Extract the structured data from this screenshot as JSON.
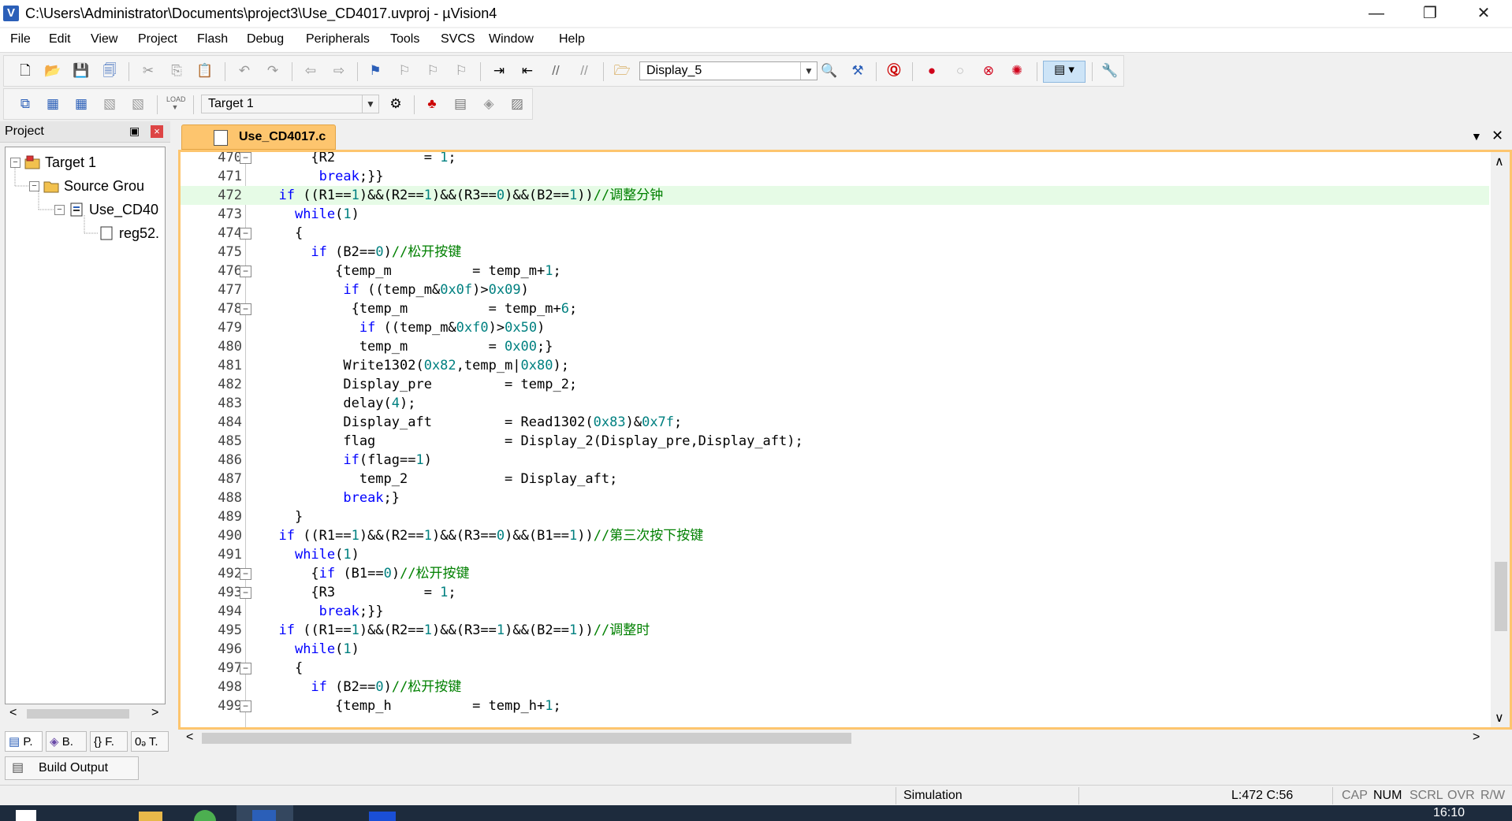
{
  "window": {
    "title": "C:\\Users\\Administrator\\Documents\\project3\\Use_CD4017.uvproj - µVision4",
    "icon_letter": "V",
    "buttons": {
      "minimize": "—",
      "restore": "❐",
      "close": "✕"
    }
  },
  "menu": [
    "File",
    "Edit",
    "View",
    "Project",
    "Flash",
    "Debug",
    "Peripherals",
    "Tools",
    "SVCS",
    "Window",
    "Help"
  ],
  "toolbar1": {
    "find_combo": "Display_5",
    "icons": [
      "new-file-icon",
      "open-icon",
      "save-icon",
      "save-all-icon",
      "cut-icon",
      "copy-icon",
      "paste-icon",
      "undo-icon",
      "redo-icon",
      "back-icon",
      "forward-icon",
      "bookmark-icon",
      "bookmark-prev-icon",
      "bookmark-next-icon",
      "bookmark-clear-icon",
      "indent-icon",
      "unindent-icon",
      "comment-icon",
      "uncomment-icon",
      "find-in-files-icon",
      "find-icon",
      "incremental-find-icon",
      "debug-start-icon",
      "breakpoint-icon",
      "breakpoint-disable-icon",
      "breakpoint-kill-icon",
      "breakpoint-kill-all-icon",
      "window-layout-icon",
      "configure-icon"
    ]
  },
  "toolbar2": {
    "target_combo": "Target 1",
    "load_label": "LOAD"
  },
  "project_panel": {
    "title": "Project",
    "pin": "▣",
    "close": "×",
    "tree": [
      {
        "label": "Target 1",
        "level": 0,
        "expander": "−"
      },
      {
        "label": "Source Grou",
        "level": 1,
        "expander": "−"
      },
      {
        "label": "Use_CD40",
        "level": 2,
        "expander": "−"
      },
      {
        "label": "reg52.",
        "level": 3,
        "expander": ""
      }
    ],
    "tabs": [
      "P.",
      "B.",
      "F.",
      "T."
    ],
    "scroll_left": "<",
    "scroll_right": ">"
  },
  "editor": {
    "tab_label": "Use_CD4017.c",
    "dropdown_icon": "▼",
    "close_icon": "✕",
    "current_line": 472,
    "lines": [
      {
        "n": "470",
        "fold": "−",
        "text": "      {R2           = 1;"
      },
      {
        "n": "471",
        "fold": "",
        "text": "       break;}}"
      },
      {
        "n": "472",
        "fold": "",
        "text": "  if ((R1==1)&&(R2==1)&&(R3==0)&&(B2==1))//调整分钟"
      },
      {
        "n": "473",
        "fold": "",
        "text": "    while(1)"
      },
      {
        "n": "474",
        "fold": "−",
        "text": "    {"
      },
      {
        "n": "475",
        "fold": "",
        "text": "      if (B2==0)//松开按键"
      },
      {
        "n": "476",
        "fold": "−",
        "text": "         {temp_m          = temp_m+1;"
      },
      {
        "n": "477",
        "fold": "",
        "text": "          if ((temp_m&0x0f)>0x09)"
      },
      {
        "n": "478",
        "fold": "−",
        "text": "           {temp_m          = temp_m+6;"
      },
      {
        "n": "479",
        "fold": "",
        "text": "            if ((temp_m&0xf0)>0x50)"
      },
      {
        "n": "480",
        "fold": "",
        "text": "            temp_m          = 0x00;}"
      },
      {
        "n": "481",
        "fold": "",
        "text": "          Write1302(0x82,temp_m|0x80);"
      },
      {
        "n": "482",
        "fold": "",
        "text": "          Display_pre         = temp_2;"
      },
      {
        "n": "483",
        "fold": "",
        "text": "          delay(4);"
      },
      {
        "n": "484",
        "fold": "",
        "text": "          Display_aft         = Read1302(0x83)&0x7f;"
      },
      {
        "n": "485",
        "fold": "",
        "text": "          flag                = Display_2(Display_pre,Display_aft);"
      },
      {
        "n": "486",
        "fold": "",
        "text": "          if(flag==1)"
      },
      {
        "n": "487",
        "fold": "",
        "text": "            temp_2            = Display_aft;"
      },
      {
        "n": "488",
        "fold": "",
        "text": "          break;}"
      },
      {
        "n": "489",
        "fold": "",
        "text": "    }"
      },
      {
        "n": "490",
        "fold": "",
        "text": "  if ((R1==1)&&(R2==1)&&(R3==0)&&(B1==1))//第三次按下按键"
      },
      {
        "n": "491",
        "fold": "",
        "text": "    while(1)"
      },
      {
        "n": "492",
        "fold": "−",
        "text": "      {if (B1==0)//松开按键"
      },
      {
        "n": "493",
        "fold": "−",
        "text": "      {R3           = 1;"
      },
      {
        "n": "494",
        "fold": "",
        "text": "       break;}}"
      },
      {
        "n": "495",
        "fold": "",
        "text": "  if ((R1==1)&&(R2==1)&&(R3==1)&&(B2==1))//调整时"
      },
      {
        "n": "496",
        "fold": "",
        "text": "    while(1)"
      },
      {
        "n": "497",
        "fold": "−",
        "text": "    {"
      },
      {
        "n": "498",
        "fold": "",
        "text": "      if (B2==0)//松开按键"
      },
      {
        "n": "499",
        "fold": "−",
        "text": "         {temp_h          = temp_h+1;"
      }
    ],
    "vscroll_up": "∧",
    "vscroll_down": "∨",
    "hscroll_left": "<",
    "hscroll_right": ">"
  },
  "build_output": {
    "label": "Build Output"
  },
  "status": {
    "mode": "Simulation",
    "position": "L:472 C:56",
    "flags": [
      "CAP",
      "NUM",
      "SCRL",
      "OVR",
      "R/W"
    ]
  },
  "taskbar": {
    "clock": "16:10"
  },
  "colors": {
    "keyword": "#0000ff",
    "number": "#008080",
    "comment": "#008000",
    "tab_accent": "#fdc56e",
    "current_line_bg": "#e6fbe6"
  }
}
